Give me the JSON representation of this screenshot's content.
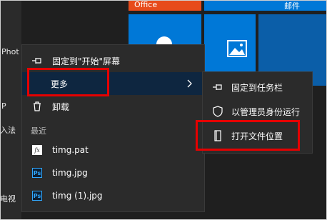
{
  "start_left": {
    "app_labels": [
      "Phot",
      "P",
      "入法",
      "电视"
    ]
  },
  "tiles": [
    {
      "id": "office",
      "label": "Office",
      "color": "#e74b1b"
    },
    {
      "id": "mail",
      "label": "邮件",
      "color": "#0078d7"
    },
    {
      "id": "people",
      "label": "",
      "color": "#0078d7"
    },
    {
      "id": "photos",
      "label": "",
      "color": "#0078d7"
    }
  ],
  "context_menu": {
    "pin_start": "固定到\"开始\"屏幕",
    "more": "更多",
    "uninstall": "卸载",
    "recent_heading": "最近",
    "recent_items": [
      {
        "label": "timg.pat",
        "icon": "fx-icon"
      },
      {
        "label": "timg.jpg",
        "icon": "ps-icon"
      },
      {
        "label": "timg (1).jpg",
        "icon": "ps-icon"
      }
    ]
  },
  "submenu": {
    "pin_taskbar": "固定到任务栏",
    "run_as_admin": "以管理员身份运行",
    "open_file_location": "打开文件位置"
  },
  "badges": {
    "fx": "fx",
    "ps": "Ps"
  },
  "colors": {
    "highlight": "#e60000",
    "menu_bg": "#2b2b2b",
    "hover_bg": "#0e2640"
  }
}
